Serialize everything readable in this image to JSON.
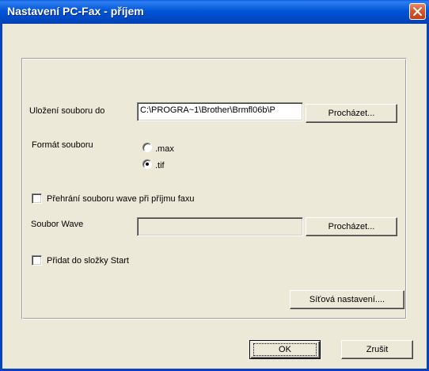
{
  "window": {
    "title": "Nastavení PC-Fax - příjem"
  },
  "save_location": {
    "label": "Uložení souboru do",
    "value": "C:\\PROGRA~1\\Brother\\Brmfl06b\\P",
    "browse_label": "Procházet..."
  },
  "file_format": {
    "label": "Formát souboru",
    "options": [
      {
        "label": ".max",
        "checked": false
      },
      {
        "label": ".tif",
        "checked": true
      }
    ]
  },
  "play_wave": {
    "label": "Přehrání souboru wave při příjmu faxu",
    "checked": false
  },
  "wave_file": {
    "label": "Soubor Wave",
    "value": "",
    "browse_label": "Procházet..."
  },
  "add_to_startup": {
    "label": "Přidat do složky Start",
    "checked": false
  },
  "network_settings_label": "Síťová nastavení....",
  "ok_label": "OK",
  "cancel_label": "Zrušit",
  "icons": {
    "close": "close-icon"
  },
  "colors": {
    "titlebar": "#0056d6",
    "dialog_face": "#ece9d8",
    "close_button": "#d8582c"
  }
}
